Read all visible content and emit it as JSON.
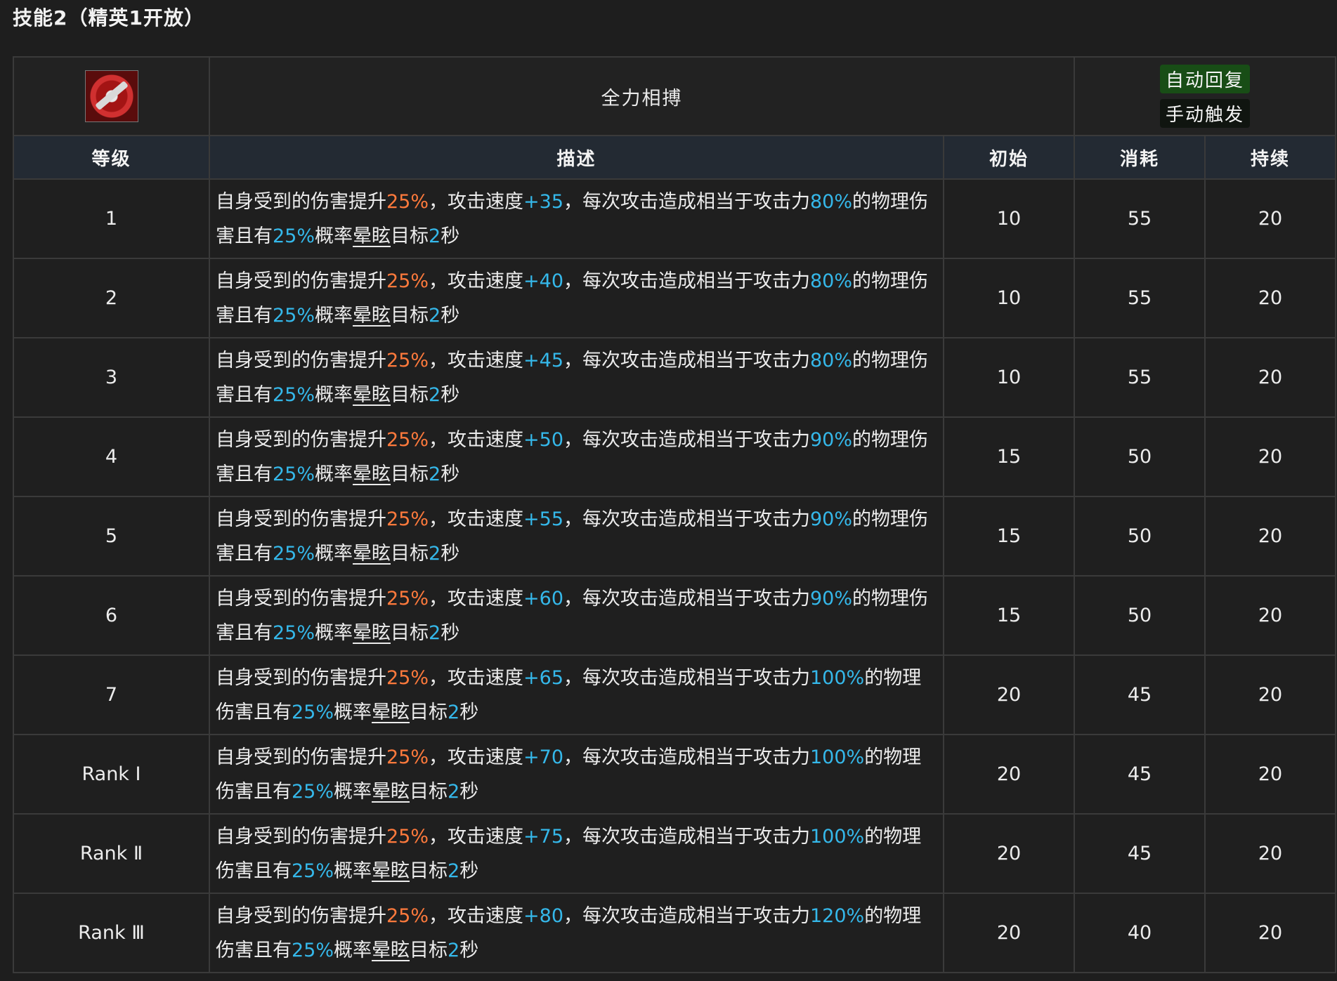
{
  "section_title": "技能2（精英1开放）",
  "skill": {
    "name": "全力相搏",
    "tag_recovery": "自动回复",
    "tag_trigger": "手动触发"
  },
  "headers": {
    "level": "等级",
    "description": "描述",
    "initial": "初始",
    "cost": "消耗",
    "duration": "持续"
  },
  "rows": [
    {
      "level": "1",
      "p1": "自身受到的伤害提升",
      "dmg": "25%",
      "p2": "，攻击速度",
      "aspd": "+35",
      "p3": "，每次攻击造成相当于攻击力",
      "atk": "80%",
      "p4": "的物理伤害且有",
      "chance": "25%",
      "p5": "概率",
      "stun": "晕眩",
      "p6": "目标",
      "sec": "2",
      "p7": "秒",
      "initial": "10",
      "cost": "55",
      "duration": "20"
    },
    {
      "level": "2",
      "p1": "自身受到的伤害提升",
      "dmg": "25%",
      "p2": "，攻击速度",
      "aspd": "+40",
      "p3": "，每次攻击造成相当于攻击力",
      "atk": "80%",
      "p4": "的物理伤害且有",
      "chance": "25%",
      "p5": "概率",
      "stun": "晕眩",
      "p6": "目标",
      "sec": "2",
      "p7": "秒",
      "initial": "10",
      "cost": "55",
      "duration": "20"
    },
    {
      "level": "3",
      "p1": "自身受到的伤害提升",
      "dmg": "25%",
      "p2": "，攻击速度",
      "aspd": "+45",
      "p3": "，每次攻击造成相当于攻击力",
      "atk": "80%",
      "p4": "的物理伤害且有",
      "chance": "25%",
      "p5": "概率",
      "stun": "晕眩",
      "p6": "目标",
      "sec": "2",
      "p7": "秒",
      "initial": "10",
      "cost": "55",
      "duration": "20"
    },
    {
      "level": "4",
      "p1": "自身受到的伤害提升",
      "dmg": "25%",
      "p2": "，攻击速度",
      "aspd": "+50",
      "p3": "，每次攻击造成相当于攻击力",
      "atk": "90%",
      "p4": "的物理伤害且有",
      "chance": "25%",
      "p5": "概率",
      "stun": "晕眩",
      "p6": "目标",
      "sec": "2",
      "p7": "秒",
      "initial": "15",
      "cost": "50",
      "duration": "20"
    },
    {
      "level": "5",
      "p1": "自身受到的伤害提升",
      "dmg": "25%",
      "p2": "，攻击速度",
      "aspd": "+55",
      "p3": "，每次攻击造成相当于攻击力",
      "atk": "90%",
      "p4": "的物理伤害且有",
      "chance": "25%",
      "p5": "概率",
      "stun": "晕眩",
      "p6": "目标",
      "sec": "2",
      "p7": "秒",
      "initial": "15",
      "cost": "50",
      "duration": "20"
    },
    {
      "level": "6",
      "p1": "自身受到的伤害提升",
      "dmg": "25%",
      "p2": "，攻击速度",
      "aspd": "+60",
      "p3": "，每次攻击造成相当于攻击力",
      "atk": "90%",
      "p4": "的物理伤害且有",
      "chance": "25%",
      "p5": "概率",
      "stun": "晕眩",
      "p6": "目标",
      "sec": "2",
      "p7": "秒",
      "initial": "15",
      "cost": "50",
      "duration": "20"
    },
    {
      "level": "7",
      "p1": "自身受到的伤害提升",
      "dmg": "25%",
      "p2": "，攻击速度",
      "aspd": "+65",
      "p3": "，每次攻击造成相当于攻击力",
      "atk": "100%",
      "p4": "的物理伤害且有",
      "chance": "25%",
      "p5": "概率",
      "stun": "晕眩",
      "p6": "目标",
      "sec": "2",
      "p7": "秒",
      "initial": "20",
      "cost": "45",
      "duration": "20"
    },
    {
      "level": "Rank Ⅰ",
      "p1": "自身受到的伤害提升",
      "dmg": "25%",
      "p2": "，攻击速度",
      "aspd": "+70",
      "p3": "，每次攻击造成相当于攻击力",
      "atk": "100%",
      "p4": "的物理伤害且有",
      "chance": "25%",
      "p5": "概率",
      "stun": "晕眩",
      "p6": "目标",
      "sec": "2",
      "p7": "秒",
      "initial": "20",
      "cost": "45",
      "duration": "20"
    },
    {
      "level": "Rank Ⅱ",
      "p1": "自身受到的伤害提升",
      "dmg": "25%",
      "p2": "，攻击速度",
      "aspd": "+75",
      "p3": "，每次攻击造成相当于攻击力",
      "atk": "100%",
      "p4": "的物理伤害且有",
      "chance": "25%",
      "p5": "概率",
      "stun": "晕眩",
      "p6": "目标",
      "sec": "2",
      "p7": "秒",
      "initial": "20",
      "cost": "45",
      "duration": "20"
    },
    {
      "level": "Rank Ⅲ",
      "p1": "自身受到的伤害提升",
      "dmg": "25%",
      "p2": "，攻击速度",
      "aspd": "+80",
      "p3": "，每次攻击造成相当于攻击力",
      "atk": "120%",
      "p4": "的物理伤害且有",
      "chance": "25%",
      "p5": "概率",
      "stun": "晕眩",
      "p6": "目标",
      "sec": "2",
      "p7": "秒",
      "initial": "20",
      "cost": "40",
      "duration": "20"
    }
  ],
  "colors": {
    "background": "#1e1e1e",
    "header_bg": "#232a33",
    "highlight_orange": "#ff7a3c",
    "highlight_blue": "#35b8ea",
    "tag_green": "#184d16"
  }
}
